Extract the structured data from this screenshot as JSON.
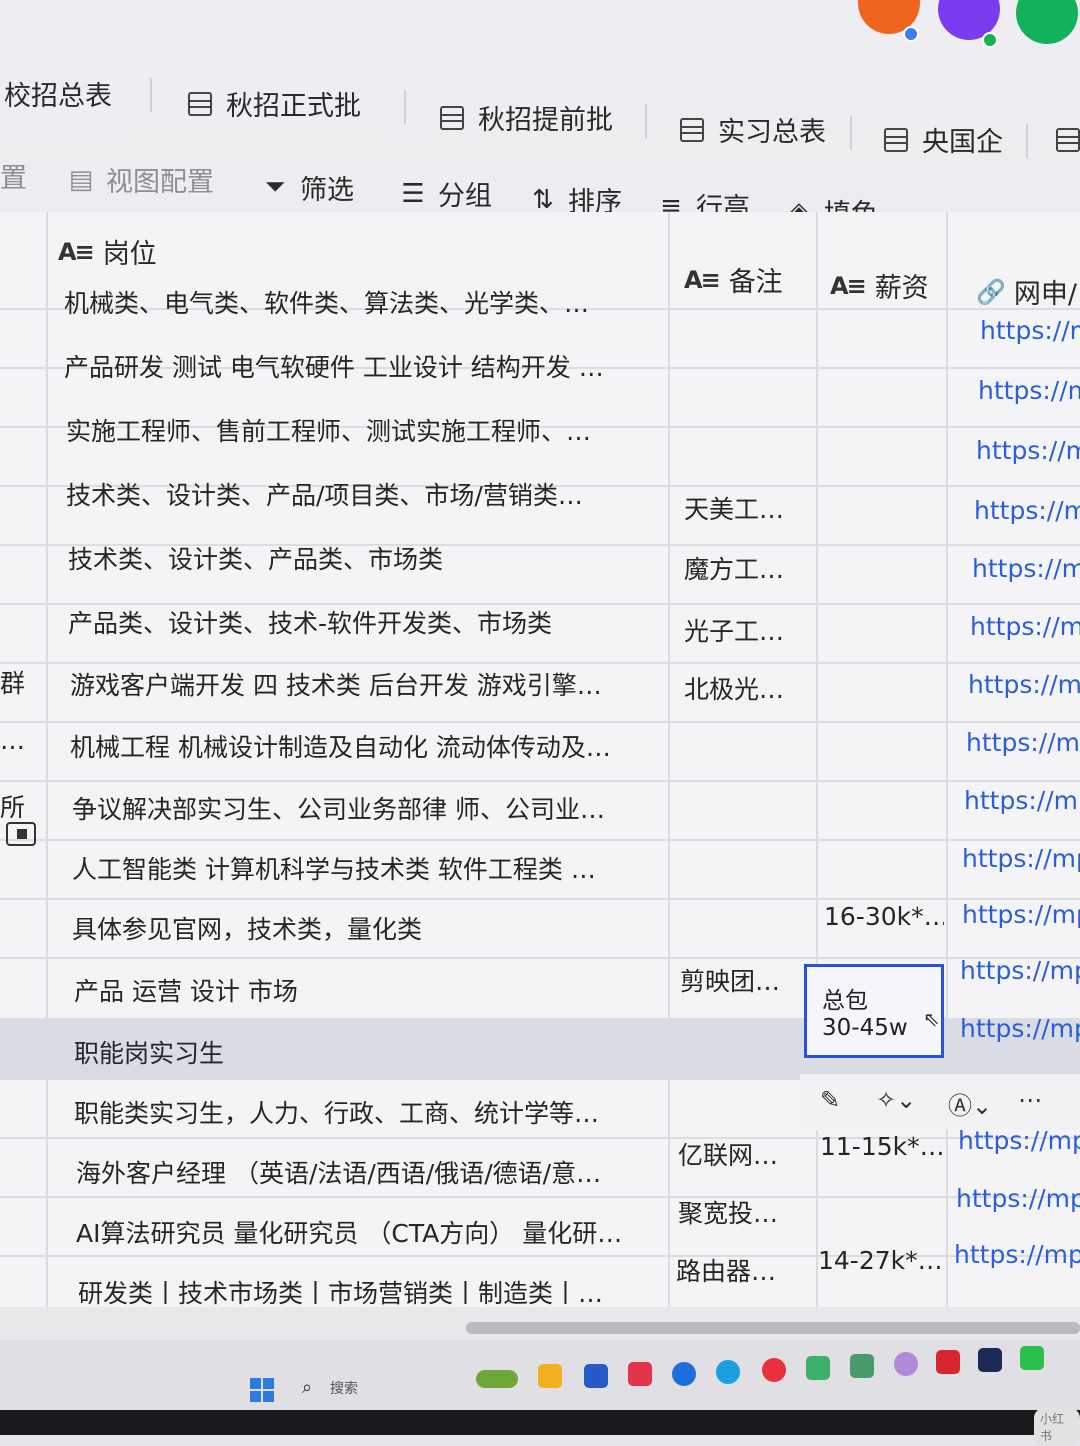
{
  "tabs": [
    {
      "label": "校招总表"
    },
    {
      "label": "秋招正式批"
    },
    {
      "label": "秋招提前批"
    },
    {
      "label": "实习总表"
    },
    {
      "label": "央国企"
    }
  ],
  "toolbar": {
    "left_cut": "置",
    "view_config": "视图配置",
    "filter": "筛选",
    "group": "分组",
    "sort": "排序",
    "row_height": "行高",
    "fill": "填色"
  },
  "columns": {
    "position": "岗位",
    "note": "备注",
    "salary": "薪资",
    "link": "网申/"
  },
  "left_cut": [
    "群",
    "…",
    "所"
  ],
  "rows": [
    {
      "position": "机械类、电气类、软件类、算法类、光学类、…",
      "note": "",
      "salary": "",
      "link": "https://m"
    },
    {
      "position": "产品研发 测试 电气软硬件 工业设计 结构开发 …",
      "note": "",
      "salary": "",
      "link": "https://m"
    },
    {
      "position": "实施工程师、售前工程师、测试实施工程师、…",
      "note": "",
      "salary": "",
      "link": "https://m"
    },
    {
      "position": "技术类、设计类、产品/项目类、市场/营销类…",
      "note": "天美工…",
      "salary": "",
      "link": "https://m"
    },
    {
      "position": "技术类、设计类、产品类、市场类",
      "note": "魔方工…",
      "salary": "",
      "link": "https://mp"
    },
    {
      "position": "产品类、设计类、技术-软件开发类、市场类",
      "note": "光子工…",
      "salary": "",
      "link": "https://mp"
    },
    {
      "position": "游戏客户端开发 四 技术类 后台开发 游戏引擎…",
      "note": "北极光…",
      "salary": "",
      "link": "https://mp"
    },
    {
      "position": "机械工程 机械设计制造及自动化 流动体传动及…",
      "note": "",
      "salary": "",
      "link": "https://mp"
    },
    {
      "position": "争议解决部实习生、公司业务部律 师、公司业…",
      "note": "",
      "salary": "",
      "link": "https://mp"
    },
    {
      "position": "人工智能类 计算机科学与技术类 软件工程类 …",
      "note": "",
      "salary": "",
      "link": "https://mp"
    },
    {
      "position": "具体参见官网，技术类，量化类",
      "note": "",
      "salary": "16-30k*…",
      "link": "https://mp."
    },
    {
      "position": "产品 运营 设计 市场",
      "note": "剪映团…",
      "salary": "",
      "link": "https://mp."
    },
    {
      "position": "职能岗实习生",
      "note": "",
      "salary": "",
      "link": "https://mp."
    },
    {
      "position": "职能类实习生，人力、行政、工商、统计学等…",
      "note": "",
      "salary": "",
      "link": ""
    },
    {
      "position": "海外客户经理 （英语/法语/西语/俄语/德语/意…",
      "note": "亿联网…",
      "salary": "11-15k*…",
      "link": "https://mp."
    },
    {
      "position": "AI算法研究员 量化研究员 （CTA方向） 量化研…",
      "note": "聚宽投…",
      "salary": "",
      "link": "https://mp."
    },
    {
      "position": "研发类丨技术市场类丨市场营销类丨制造类丨…",
      "note": "路由器…",
      "salary": "14-27k*…",
      "link": "https://mp.w"
    }
  ],
  "selected_cell": {
    "line1": "总包",
    "line2": "30-45w"
  },
  "taskbar": {
    "search": "搜索"
  },
  "watermark": "小红书"
}
